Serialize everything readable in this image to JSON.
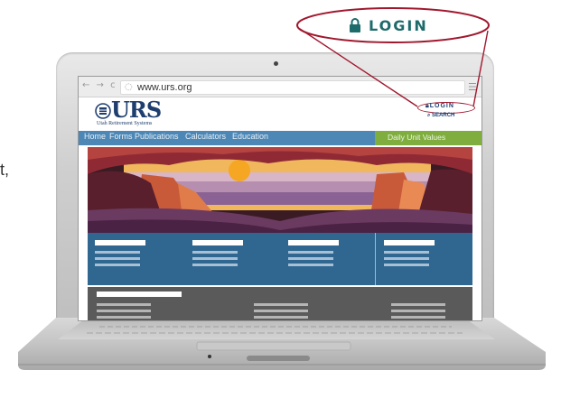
{
  "side_text": "t,",
  "callout": {
    "label": "LOGIN",
    "icon": "lock-icon"
  },
  "browser": {
    "nav_arrows": "← → c",
    "url": "www.urs.org",
    "menu_icon": "hamburger-menu-icon"
  },
  "site": {
    "logo": "URS",
    "logo_subtitle": "Utah Retirement Systems",
    "login_label": "LOGIN",
    "search_label": "SEARCH",
    "nav": [
      "Home",
      "Forms",
      "Publications",
      "Calculators",
      "Education"
    ],
    "daily_unit_values": "Daily Unit Values"
  },
  "colors": {
    "brand_navy": "#1f3e70",
    "nav_blue": "#4c87b5",
    "daily_green": "#7fae3f",
    "card_blue": "#2f6790",
    "highlight_red": "#a0182e"
  }
}
